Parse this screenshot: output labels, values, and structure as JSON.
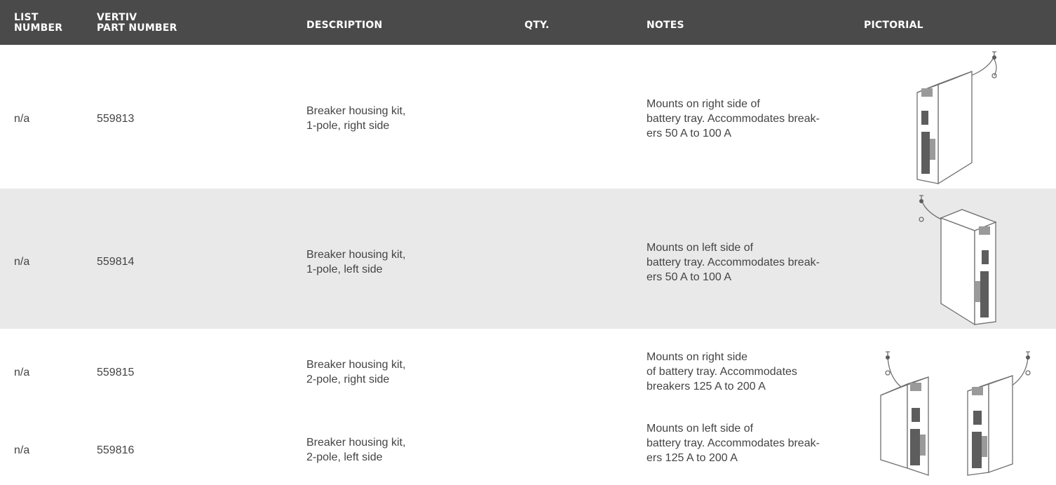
{
  "table": {
    "headers": {
      "list_number": "LIST NUMBER",
      "list_number_l1": "LIST",
      "list_number_l2": "NUMBER",
      "part_number_l1": "VERTIV",
      "part_number_l2": "PART NUMBER",
      "description": "DESCRIPTION",
      "qty": "QTY.",
      "notes": "NOTES",
      "pictorial": "PICTORIAL"
    },
    "rows": [
      {
        "list_number": "n/a",
        "part_number": "559813",
        "description": [
          "Breaker housing kit,",
          "1-pole, right side"
        ],
        "qty": "",
        "notes": [
          "Mounts on right side of",
          "battery tray. Accommodates break-",
          "ers 50 A to 100 A"
        ]
      },
      {
        "list_number": "n/a",
        "part_number": "559814",
        "description": [
          "Breaker housing kit,",
          "1-pole, left side"
        ],
        "qty": "",
        "notes": [
          "Mounts on left side of",
          "battery tray. Accommodates break-",
          "ers 50 A to 100 A"
        ]
      },
      {
        "list_number": "n/a",
        "part_number": "559815",
        "description": [
          "Breaker housing kit,",
          "2-pole, right side"
        ],
        "qty": "",
        "notes": [
          "Mounts on right side",
          "of battery tray. Accommodates",
          "breakers 125 A to 200 A"
        ]
      },
      {
        "list_number": "n/a",
        "part_number": "559816",
        "description": [
          "Breaker housing kit,",
          "2-pole, left side"
        ],
        "qty": "",
        "notes": [
          "Mounts on left side of",
          "battery tray. Accommodates break-",
          "ers 125 A to 200 A"
        ]
      }
    ]
  },
  "colors": {
    "header_bg": "#4a4a4a",
    "header_text": "#ffffff",
    "shaded_row": "#e9e9e9",
    "body_text": "#444444"
  },
  "pictorials": [
    "breaker-housing-1-pole-right-drawing",
    "breaker-housing-1-pole-left-drawing",
    "breaker-housing-2-pole-drawing"
  ]
}
